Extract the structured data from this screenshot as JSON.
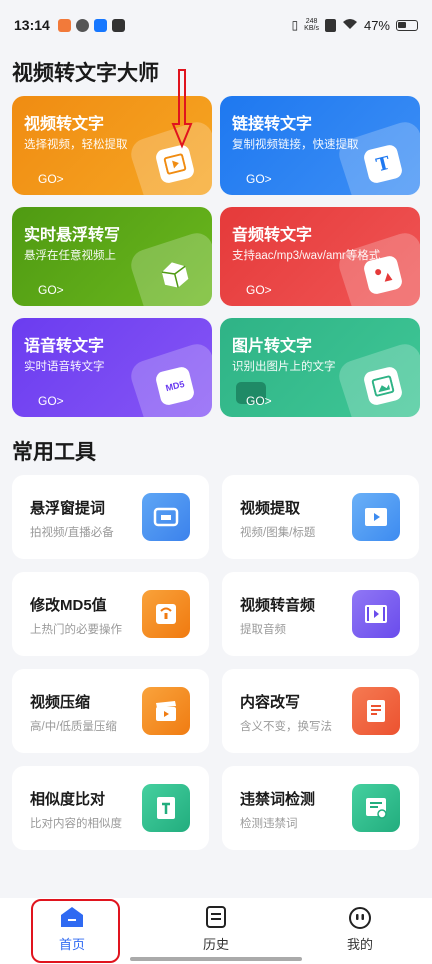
{
  "status_bar": {
    "time": "13:14",
    "net_speed_value": "248",
    "net_speed_unit": "KB/s",
    "battery": "47%"
  },
  "header": {
    "title": "视频转文字大师"
  },
  "feature_cards": [
    {
      "title": "视频转文字",
      "subtitle": "选择视频，轻松提取",
      "go": "GO>",
      "icon": "video-play-icon",
      "color": "#f08c12"
    },
    {
      "title": "链接转文字",
      "subtitle": "复制视频链接，快速提取",
      "go": "GO>",
      "icon": "text-t-icon",
      "color": "#1e78f0"
    },
    {
      "title": "实时悬浮转写",
      "subtitle": "悬浮在任意视频上",
      "go": "GO>",
      "icon": "cube-icon",
      "color": "#4f9a12"
    },
    {
      "title": "音频转文字",
      "subtitle": "支持aac/mp3/wav/amr等格式",
      "go": "GO>",
      "icon": "audio-file-icon",
      "color": "#e53a3a"
    },
    {
      "title": "语音转文字",
      "subtitle": "实时语音转文字",
      "go": "GO>",
      "icon": "md5-file-icon",
      "badge_text": "MD5",
      "color": "#6b3cf0"
    },
    {
      "title": "图片转文字",
      "subtitle": "识别出图片上的文字",
      "go": "GO>",
      "icon": "image-icon",
      "color": "#2fb386"
    }
  ],
  "tools_section": {
    "title": "常用工具"
  },
  "tools": [
    {
      "title": "悬浮窗提词",
      "subtitle": "拍视频/直播必备",
      "icon": "float-window-icon",
      "color": "#4a90f0"
    },
    {
      "title": "视频提取",
      "subtitle": "视频/图集/标题",
      "icon": "video-extract-icon",
      "color": "#4a9af2"
    },
    {
      "title": "修改MD5值",
      "subtitle": "上热门的必要操作",
      "icon": "md5-edit-icon",
      "color": "#f5891e"
    },
    {
      "title": "视频转音频",
      "subtitle": "提取音频",
      "icon": "film-audio-icon",
      "color": "#7a5cf0"
    },
    {
      "title": "视频压缩",
      "subtitle": "高/中/低质量压缩",
      "icon": "clapper-icon",
      "color": "#f58a1e"
    },
    {
      "title": "内容改写",
      "subtitle": "含义不变，换写法",
      "icon": "document-icon",
      "color": "#f0633a"
    },
    {
      "title": "相似度比对",
      "subtitle": "比对内容的相似度",
      "icon": "text-compare-icon",
      "color": "#2fbf8f"
    },
    {
      "title": "违禁词检测",
      "subtitle": "检测违禁词",
      "icon": "check-doc-icon",
      "color": "#2fbf8f"
    }
  ],
  "bottom_nav": [
    {
      "label": "首页",
      "icon": "home-icon",
      "active": true,
      "color": "#2f6af2"
    },
    {
      "label": "历史",
      "icon": "history-icon",
      "active": false
    },
    {
      "label": "我的",
      "icon": "profile-icon",
      "active": false
    }
  ]
}
